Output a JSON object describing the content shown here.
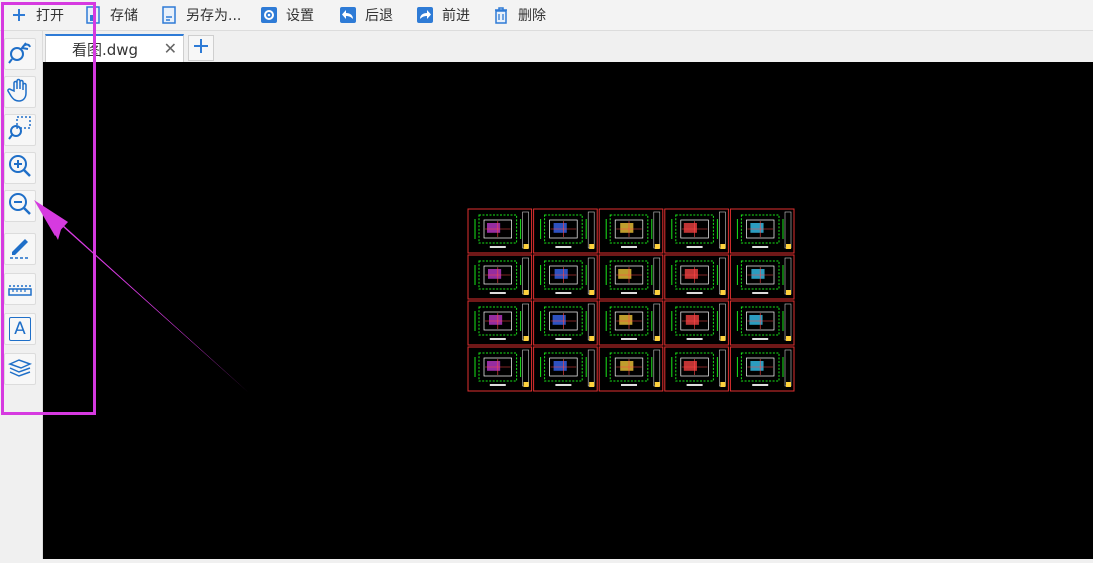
{
  "toolbar": {
    "items": [
      {
        "label": "打开",
        "icon": "plus-icon"
      },
      {
        "label": "存储",
        "icon": "save-icon"
      },
      {
        "label": "另存为...",
        "icon": "save-as-icon"
      },
      {
        "label": "设置",
        "icon": "gear-icon"
      },
      {
        "label": "后退",
        "icon": "back-arrow-icon"
      },
      {
        "label": "前进",
        "icon": "forward-arrow-icon"
      },
      {
        "label": "删除",
        "icon": "trash-icon"
      }
    ]
  },
  "left_tools": [
    {
      "icon": "zoom-previous-icon"
    },
    {
      "icon": "pan-hand-icon"
    },
    {
      "icon": "zoom-window-icon"
    },
    {
      "icon": "zoom-in-icon"
    },
    {
      "icon": "zoom-out-icon"
    },
    {
      "icon": "pencil-markup-icon"
    },
    {
      "icon": "measure-ruler-icon"
    },
    {
      "icon": "text-icon",
      "glyph": "A"
    },
    {
      "icon": "layers-icon"
    }
  ],
  "tabs": [
    {
      "label": "看图.dwg",
      "close": "✕"
    }
  ],
  "tab_add_label": "+",
  "colors": {
    "accent": "#2e7bd6",
    "canvas": "#000000",
    "annotation": "#d63ae0",
    "frame_red": "#e03030",
    "drawing_green": "#19e619"
  },
  "drawing_grid": {
    "rows": 4,
    "cols": 5
  }
}
